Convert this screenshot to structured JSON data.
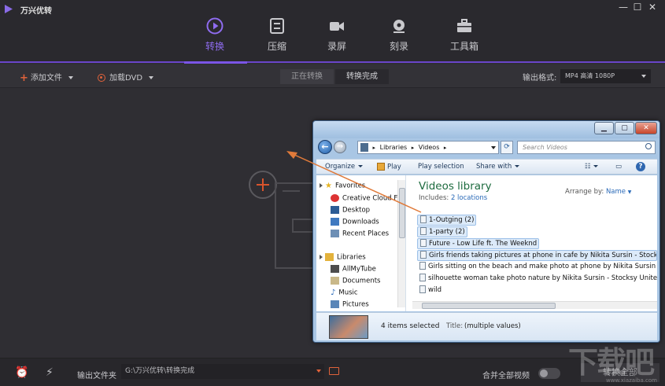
{
  "app": {
    "title": "万兴优转",
    "window_controls": {
      "minimize": "—",
      "maximize": "☐",
      "close": "✕"
    }
  },
  "nav": {
    "tabs": [
      {
        "label": "转换",
        "icon": "play-circle-icon",
        "active": true
      },
      {
        "label": "压缩",
        "icon": "compress-icon",
        "active": false
      },
      {
        "label": "录屏",
        "icon": "video-camera-icon",
        "active": false
      },
      {
        "label": "刻录",
        "icon": "disc-icon",
        "active": false
      },
      {
        "label": "工具箱",
        "icon": "toolbox-icon",
        "active": false
      }
    ]
  },
  "toolbar": {
    "add_file": "添加文件",
    "load_dvd": "加载DVD",
    "seg_converting": "正在转换",
    "seg_done": "转换完成",
    "output_format_label": "输出格式:",
    "output_format_value": "MP4 高清 1080P"
  },
  "bottom": {
    "output_folder_label": "输出文件夹",
    "output_path": "G:\\万兴优转\\转换完成",
    "merge_label": "合并全部视频",
    "merge_enabled": false,
    "convert_all": "转换全部"
  },
  "explorer": {
    "breadcrumb": [
      "Libraries",
      "Videos"
    ],
    "search_placeholder": "Search Videos",
    "commands": {
      "organize": "Organize",
      "play": "Play",
      "play_selection": "Play selection",
      "share_with": "Share with"
    },
    "nav": {
      "favorites": "Favorites",
      "favorites_items": [
        "Creative Cloud Fi",
        "Desktop",
        "Downloads",
        "Recent Places"
      ],
      "libraries": "Libraries",
      "libraries_items": [
        "AllMyTube",
        "Documents",
        "Music",
        "Pictures"
      ]
    },
    "library_title": "Videos library",
    "includes_label": "Includes:",
    "includes_link": "2 locations",
    "arrange_label": "Arrange by:",
    "arrange_value": "Name",
    "files": [
      {
        "name": "1-Outging (2)",
        "selected": true
      },
      {
        "name": "1-party (2)",
        "selected": true
      },
      {
        "name": "Future - Low Life ft. The Weeknd",
        "selected": true
      },
      {
        "name": "Girls friends taking pictures at phone in cafe by Nikita Sursin - Stocksy United",
        "selected": true
      },
      {
        "name": "Girls sitting on the beach and make photo at phone by Nikita Sursin - Stocksy United",
        "selected": false
      },
      {
        "name": "silhouette woman take photo nature by Nikita Sursin - Stocksy United",
        "selected": false
      },
      {
        "name": "wild",
        "selected": false
      }
    ],
    "status_count": "4 items selected",
    "status_title_label": "Title:",
    "status_title_value": "(multiple values)"
  },
  "watermark": {
    "main": "下载吧",
    "sub": "www.xiazaiba.com"
  },
  "colors": {
    "accent": "#7b55e6",
    "orange": "#e0623a",
    "background": "#2f2e33"
  }
}
